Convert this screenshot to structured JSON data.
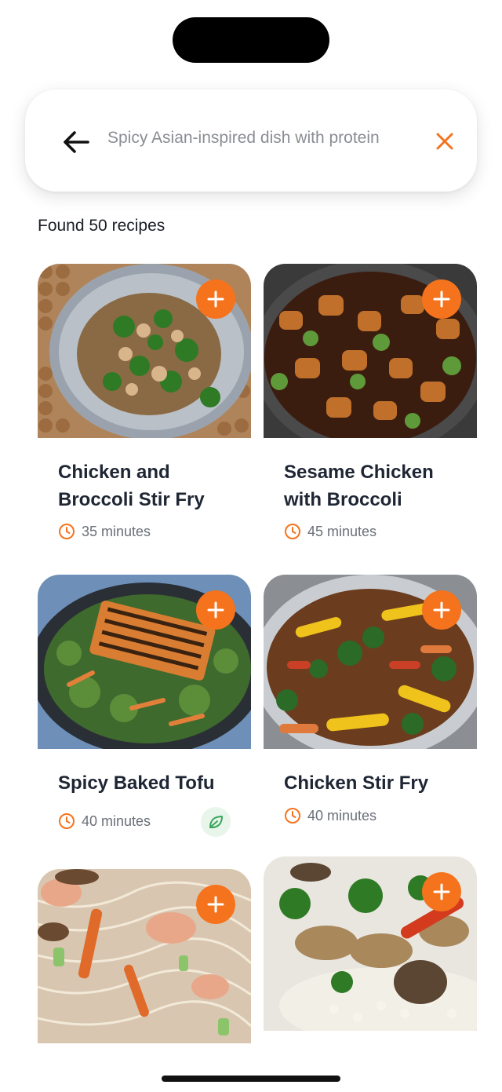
{
  "search": {
    "query": "Spicy Asian-inspired dish with protein"
  },
  "results": {
    "count_label": "Found 50 recipes"
  },
  "recipes": [
    {
      "title": "Chicken and Broccoli Stir Fry",
      "time": "35 minutes"
    },
    {
      "title": "Sesame Chicken with Broccoli",
      "time": "45 minutes"
    },
    {
      "title": "Spicy Baked Tofu",
      "time": "40 minutes",
      "vegetarian": true
    },
    {
      "title": "Chicken Stir Fry",
      "time": "40 minutes"
    },
    {
      "title": "",
      "time": ""
    },
    {
      "title": "",
      "time": ""
    }
  ],
  "colors": {
    "accent": "#f5731c",
    "text": "#1e2533",
    "muted": "#6a6f78",
    "leaf_green": "#3aa55a"
  },
  "icons": {
    "back": "arrow-left-icon",
    "clear": "close-icon",
    "add": "plus-icon",
    "time": "clock-icon",
    "vegetarian": "leaf-icon"
  }
}
